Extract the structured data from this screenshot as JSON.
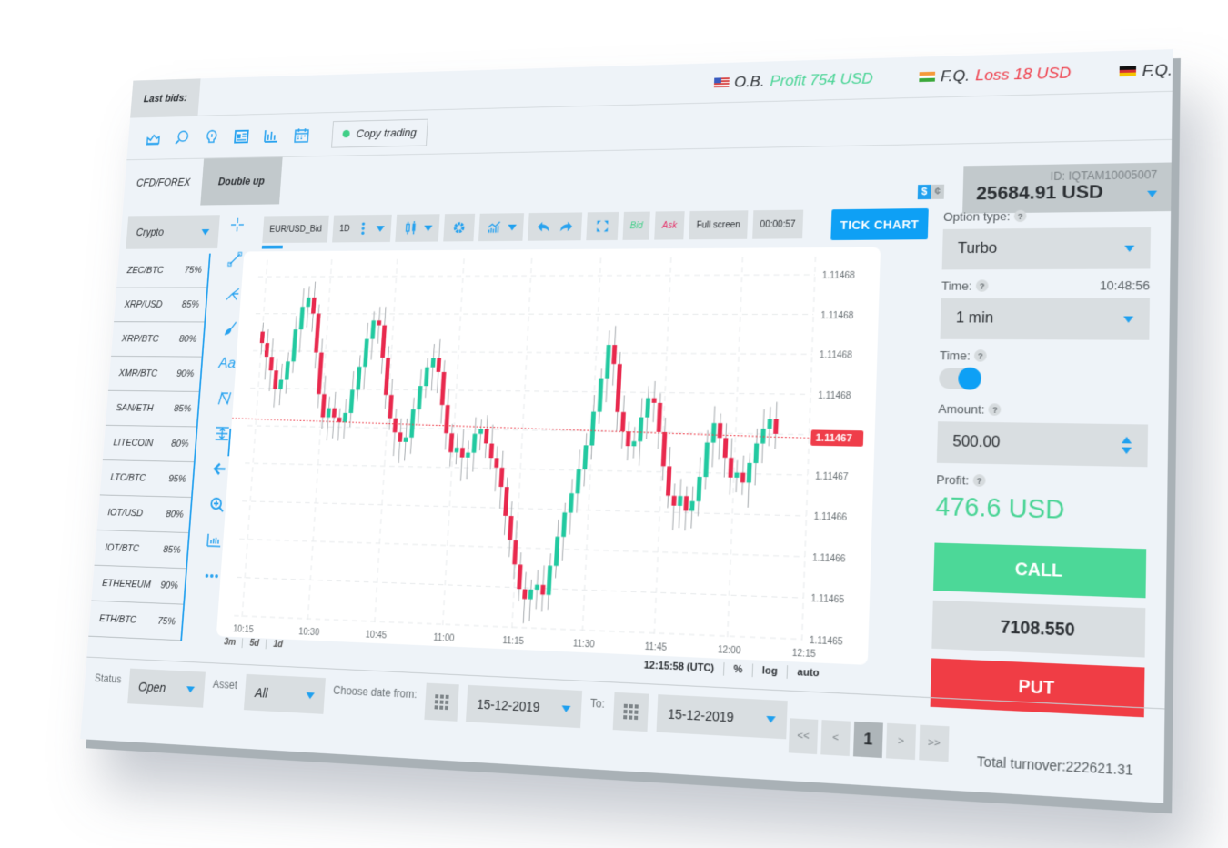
{
  "topbar": {
    "last_bids_label": "Last bids:",
    "bids": [
      {
        "flag": "us-flag",
        "trader": "O.B.",
        "result": "Profit 754 USD",
        "kind": "profit"
      },
      {
        "flag": "india-flag",
        "trader": "F.Q.",
        "result": "Loss 18 USD",
        "kind": "loss"
      },
      {
        "flag": "germany-flag",
        "trader": "F.Q.",
        "result": "",
        "kind": "unknown"
      }
    ]
  },
  "toolbar_icons": [
    "area-chart-icon",
    "globe-search-icon",
    "lightbulb-icon",
    "news-icon",
    "candlestick-stats-icon",
    "calendar-icon"
  ],
  "copy_trading": {
    "label": "Copy trading",
    "status_color": "#3fcf87"
  },
  "mode_tabs": [
    {
      "label": "CFD/FOREX",
      "active": false
    },
    {
      "label": "Double up",
      "active": true
    }
  ],
  "currency_toggle": {
    "primary": "$",
    "secondary": "¢"
  },
  "account": {
    "id": "ID: IQTAM10005007",
    "balance": "25684.91 USD"
  },
  "asset_filter": {
    "selected": "Crypto"
  },
  "assets": [
    {
      "name": "ZEC/BTC",
      "payout": "75%"
    },
    {
      "name": "XRP/USD",
      "payout": "85%"
    },
    {
      "name": "XRP/BTC",
      "payout": "80%"
    },
    {
      "name": "XMR/BTC",
      "payout": "90%"
    },
    {
      "name": "SAN/ETH",
      "payout": "85%"
    },
    {
      "name": "LITECOIN",
      "payout": "80%"
    },
    {
      "name": "LTC/BTC",
      "payout": "95%"
    },
    {
      "name": "IOT/USD",
      "payout": "80%"
    },
    {
      "name": "IOT/BTC",
      "payout": "85%"
    },
    {
      "name": "ETHEREUM",
      "payout": "90%"
    },
    {
      "name": "ETH/BTC",
      "payout": "75%"
    }
  ],
  "draw_tools": [
    "crosshair-icon",
    "trend-line-icon",
    "pitchfork-icon",
    "brush-icon",
    "text-tool-icon",
    "pattern-icon",
    "measure-icon",
    "back-arrow-icon",
    "zoom-in-icon",
    "ruler-icon",
    "more-icon"
  ],
  "text_tool_label": "Aa",
  "chart_toolbar": {
    "symbol": "EUR/USD_Bid",
    "interval": "1D",
    "bid_label": "Bid",
    "ask_label": "Ask",
    "fullscreen_label": "Full screen",
    "countdown": "00:00:57",
    "tick_chart_label": "TICK CHART"
  },
  "chart_data": {
    "type": "candlestick",
    "symbol": "EUR/USD_Bid",
    "x_ticks": [
      "10:15",
      "10:30",
      "10:45",
      "11:00",
      "11:15",
      "11:30",
      "11:45",
      "12:00",
      "12:15"
    ],
    "y_ticks": [
      "1.11468",
      "1.11468",
      "1.11468",
      "1.11468",
      "1.11467",
      "1.11467",
      "1.11466",
      "1.11466",
      "1.11465",
      "1.11465"
    ],
    "current_price": "1.11467",
    "current_price_level": 0.39,
    "grid": true,
    "up_color": "#22c9a0",
    "down_color": "#e8294d",
    "closes_normalized": [
      0.72,
      0.66,
      0.6,
      0.52,
      0.56,
      0.64,
      0.78,
      0.88,
      0.92,
      0.85,
      0.68,
      0.5,
      0.4,
      0.44,
      0.4,
      0.38,
      0.42,
      0.52,
      0.62,
      0.74,
      0.82,
      0.8,
      0.66,
      0.5,
      0.4,
      0.34,
      0.3,
      0.32,
      0.44,
      0.54,
      0.62,
      0.66,
      0.6,
      0.46,
      0.34,
      0.26,
      0.28,
      0.24,
      0.26,
      0.34,
      0.36,
      0.3,
      0.24,
      0.2,
      0.12,
      0.0,
      -0.1,
      -0.2,
      -0.3,
      -0.34,
      -0.3,
      -0.28,
      -0.32,
      -0.2,
      -0.08,
      0.02,
      0.1,
      0.2,
      0.3,
      0.44,
      0.58,
      0.72,
      0.64,
      0.44,
      0.36,
      0.3,
      0.32,
      0.42,
      0.5,
      0.48,
      0.36,
      0.22,
      0.1,
      0.06,
      0.1,
      0.04,
      0.08,
      0.18,
      0.32,
      0.4,
      0.34,
      0.26,
      0.18,
      0.2,
      0.16,
      0.24,
      0.32,
      0.38,
      0.42,
      0.36
    ],
    "time_readout": "12:15:58 (UTC)",
    "scale_options": [
      "%",
      "log",
      "auto"
    ],
    "periods": [
      "3m",
      "5d",
      "1d"
    ]
  },
  "trade_panel": {
    "option_type_label": "Option type:",
    "option_type": "Turbo",
    "time_label": "Time:",
    "clock": "10:48:56",
    "time_value": "1 min",
    "time_toggle_label": "Time:",
    "time_toggle_on": true,
    "amount_label": "Amount:",
    "amount": "500.00",
    "profit_label": "Profit:",
    "profit": "476.6 USD",
    "call_label": "CALL",
    "strike": "7108.550",
    "put_label": "PUT",
    "help_glyph": "?"
  },
  "filters": {
    "status_label": "Status",
    "status": "Open",
    "asset_label": "Asset",
    "asset": "All",
    "from_label": "Choose date from:",
    "from_date": "15-12-2019",
    "to_label": "To:",
    "to_date": "15-12-2019"
  },
  "pagination": {
    "first": "<<",
    "prev": "<",
    "current": "1",
    "next": ">",
    "last": ">>"
  },
  "total_turnover": "Total turnover:222621.31",
  "colors": {
    "accent": "#0ea0f5",
    "profit": "#49d495",
    "loss": "#ef3d4a",
    "call": "#4cd898",
    "put": "#f03d45"
  }
}
